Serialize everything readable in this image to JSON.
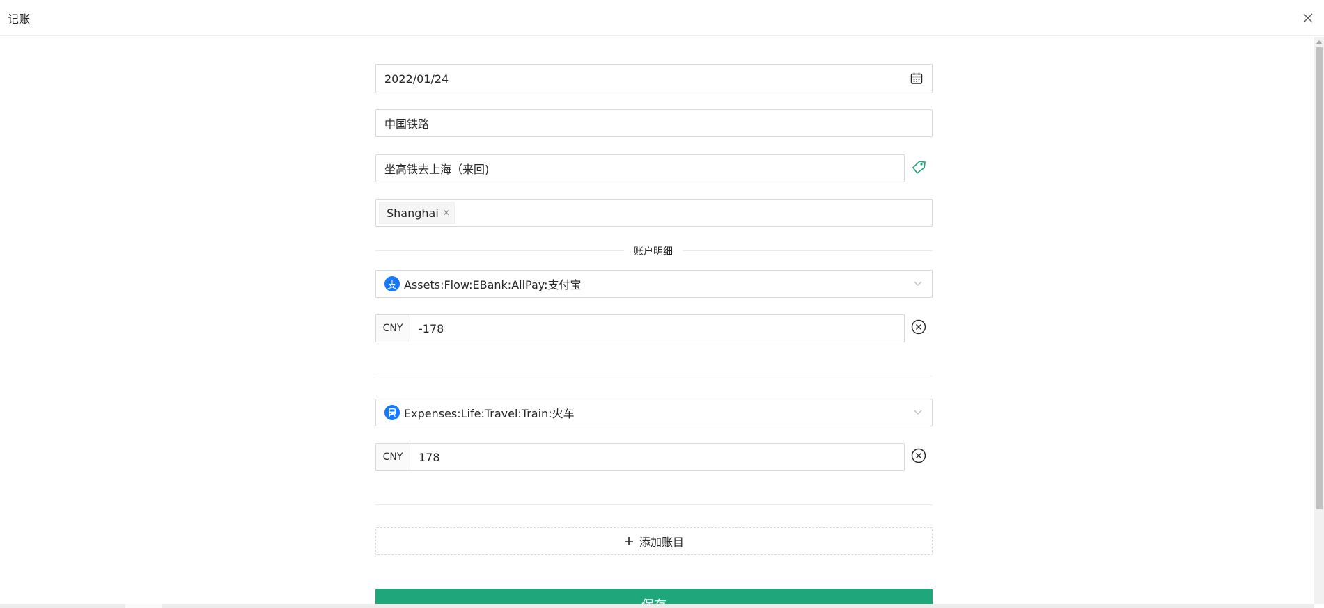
{
  "modal": {
    "title": "记账"
  },
  "form": {
    "date": "2022/01/24",
    "payee": "中国铁路",
    "narration": "坐高铁去上海（来回)",
    "tags": [
      "Shanghai"
    ],
    "divider_label": "账户明细",
    "entries": [
      {
        "account": "Assets:Flow:EBank:AliPay:支付宝",
        "currency": "CNY",
        "amount": "-178",
        "icon": "alipay-icon",
        "icon_glyph": "支",
        "icon_color": "#1677ff"
      },
      {
        "account": "Expenses:Life:Travel:Train:火车",
        "currency": "CNY",
        "amount": "178",
        "icon": "train-icon",
        "icon_glyph": "",
        "icon_color": "#1677ff"
      }
    ],
    "add_entry_label": "添加账目",
    "save_label": "保存"
  },
  "colors": {
    "accent": "#1fa67a",
    "border": "#d9d9d9",
    "tag_icon": "#1fa67a"
  }
}
